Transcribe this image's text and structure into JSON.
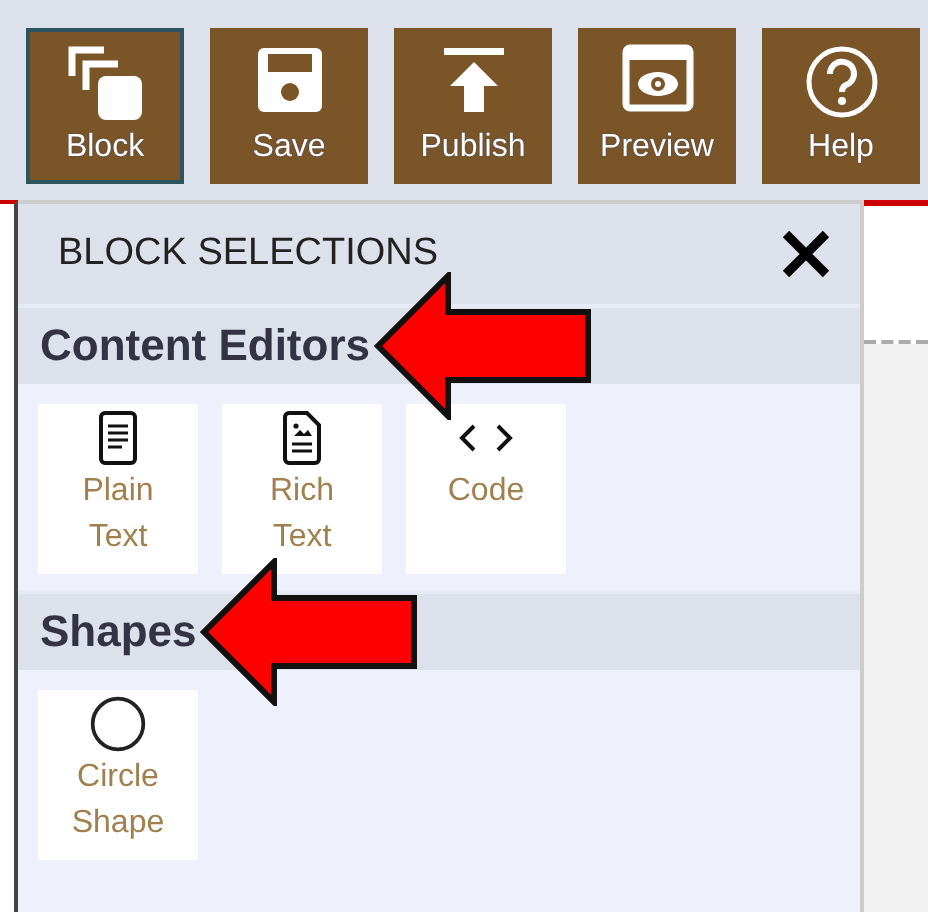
{
  "toolbar": [
    {
      "label": "Block",
      "kind": "blocks",
      "selected": true
    },
    {
      "label": "Save",
      "kind": "save",
      "selected": false
    },
    {
      "label": "Publish",
      "kind": "publish",
      "selected": false
    },
    {
      "label": "Preview",
      "kind": "preview",
      "selected": false
    },
    {
      "label": "Help",
      "kind": "help",
      "selected": false
    }
  ],
  "panel": {
    "title": "BLOCK SELECTIONS",
    "categories": [
      {
        "title": "Content Editors",
        "arrow": true,
        "items": [
          {
            "label": "Plain Text",
            "kind": "plain"
          },
          {
            "label": "Rich Text",
            "kind": "rich"
          },
          {
            "label": "Code",
            "kind": "code"
          }
        ]
      },
      {
        "title": "Shapes",
        "arrow": true,
        "items": [
          {
            "label": "Circle Shape",
            "kind": "circle"
          }
        ]
      }
    ]
  }
}
